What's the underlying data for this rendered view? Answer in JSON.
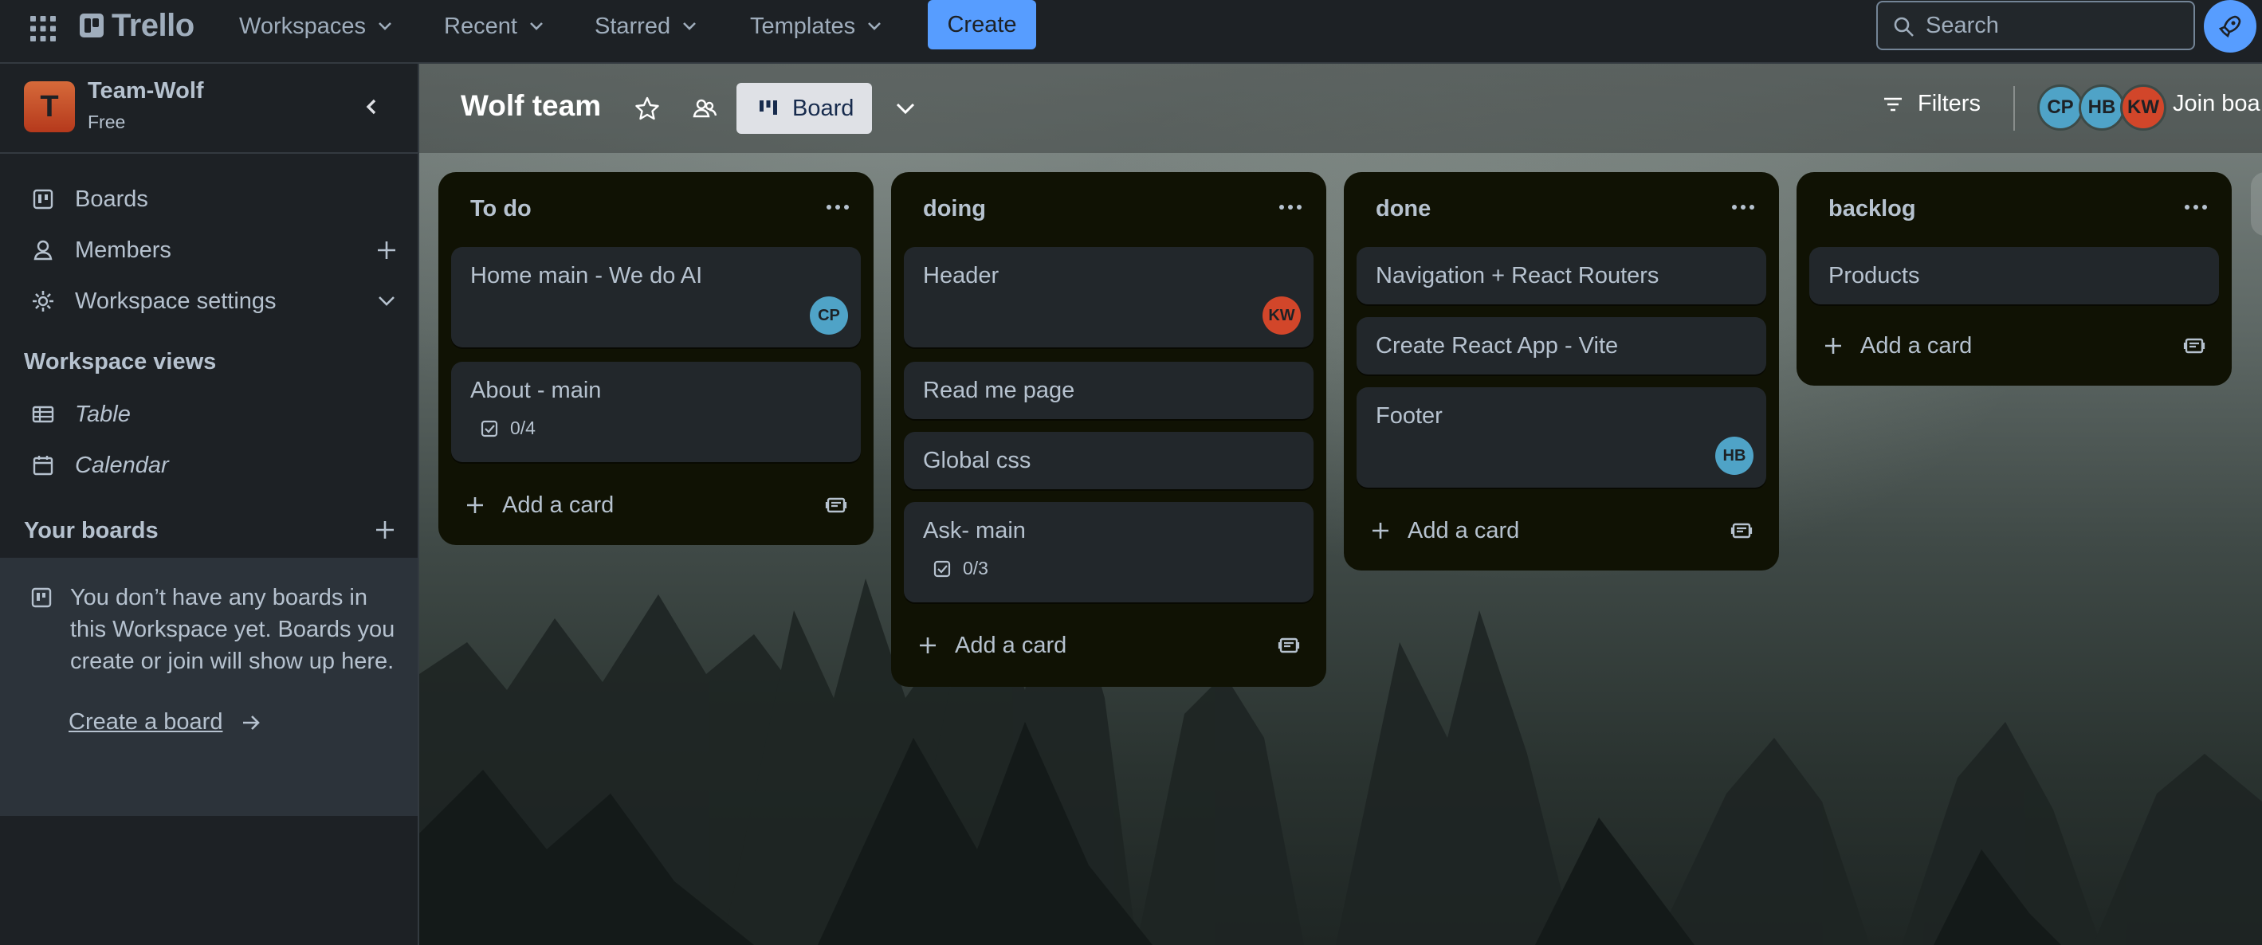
{
  "topbar": {
    "logo": "Trello",
    "nav": [
      "Workspaces",
      "Recent",
      "Starred",
      "Templates"
    ],
    "create_label": "Create",
    "search_placeholder": "Search"
  },
  "sidebar": {
    "workspace_initial": "T",
    "workspace_name": "Team-Wolf",
    "workspace_plan": "Free",
    "items": [
      {
        "label": "Boards"
      },
      {
        "label": "Members"
      },
      {
        "label": "Workspace settings"
      }
    ],
    "views_heading": "Workspace views",
    "views": [
      {
        "label": "Table"
      },
      {
        "label": "Calendar"
      }
    ],
    "your_boards_heading": "Your boards",
    "empty_text": "You don’t have any boards in this Workspace yet. Boards you create or join will show up here.",
    "create_board_label": "Create a board"
  },
  "board": {
    "title": "Wolf team",
    "view_label": "Board",
    "filters_label": "Filters",
    "join_label": "Join boa",
    "members": [
      {
        "initials": "CP",
        "color": "#4fa3c7"
      },
      {
        "initials": "HB",
        "color": "#4fa3c7"
      },
      {
        "initials": "KW",
        "color": "#d2462a"
      }
    ],
    "add_card_label": "Add a card",
    "lists": [
      {
        "title": "To do",
        "cards": [
          {
            "title": "Home main - We do AI",
            "member": "CP",
            "member_color": "#4fa3c7"
          },
          {
            "title": "About - main",
            "checklist": "0/4"
          }
        ]
      },
      {
        "title": "doing",
        "cards": [
          {
            "title": "Header",
            "member": "KW",
            "member_color": "#d2462a"
          },
          {
            "title": "Read me page"
          },
          {
            "title": "Global css"
          },
          {
            "title": "Ask- main",
            "checklist": "0/3"
          }
        ]
      },
      {
        "title": "done",
        "cards": [
          {
            "title": "Navigation + React Routers"
          },
          {
            "title": "Create React App - Vite"
          },
          {
            "title": "Footer",
            "member": "HB",
            "member_color": "#4fa3c7"
          }
        ]
      },
      {
        "title": "backlog",
        "cards": [
          {
            "title": "Products"
          }
        ]
      }
    ]
  }
}
